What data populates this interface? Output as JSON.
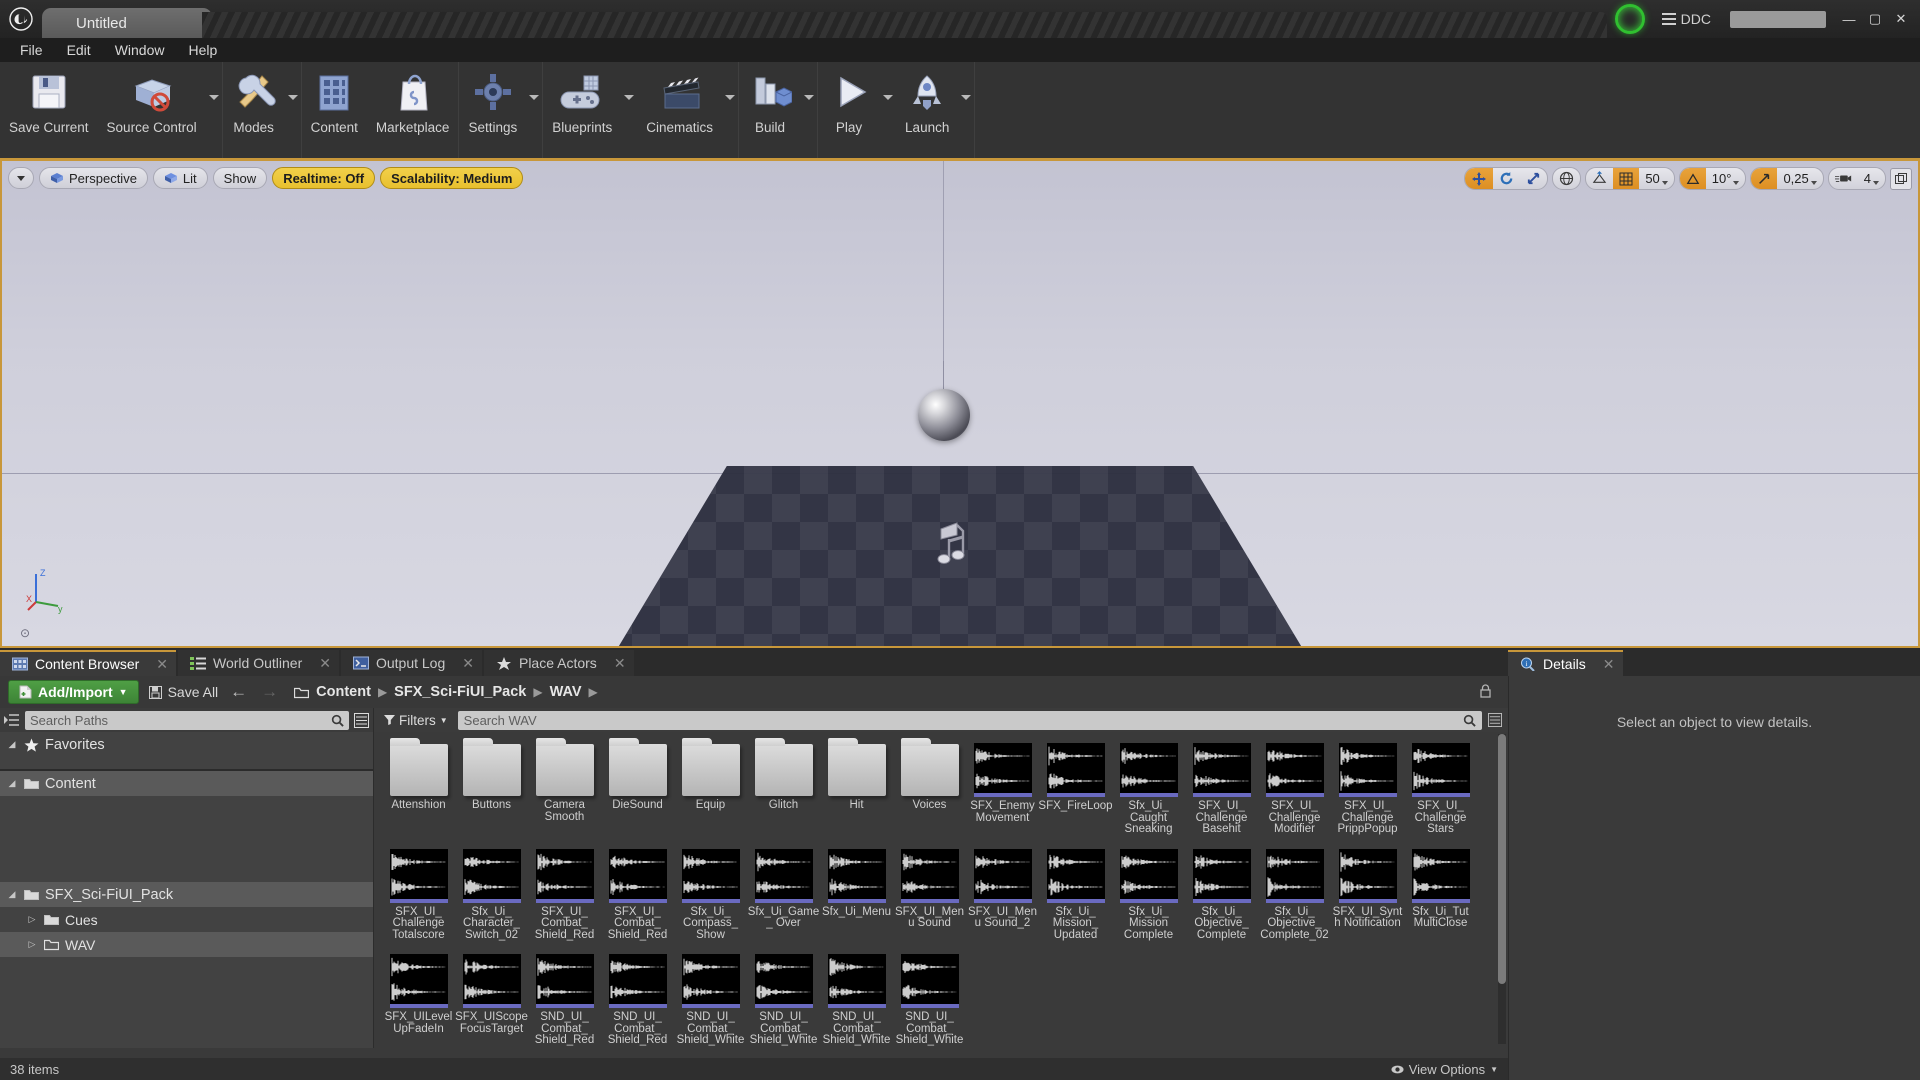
{
  "window": {
    "project_tab": "Untitled",
    "ddc_label": "DDC",
    "minimize": "—",
    "maximize": "▢",
    "close": "✕"
  },
  "menu": {
    "items": [
      "File",
      "Edit",
      "Window",
      "Help"
    ]
  },
  "toolbar": {
    "groups": [
      {
        "items": [
          {
            "label": "Save Current",
            "icon": "floppy-disk-icon",
            "arrow": false
          },
          {
            "label": "Source Control",
            "icon": "source-control-icon",
            "arrow": true
          }
        ]
      },
      {
        "items": [
          {
            "label": "Modes",
            "icon": "wrench-tools-icon",
            "arrow": true
          }
        ]
      },
      {
        "items": [
          {
            "label": "Content",
            "icon": "content-grid-icon",
            "arrow": false
          },
          {
            "label": "Marketplace",
            "icon": "marketplace-bag-icon",
            "arrow": false
          }
        ]
      },
      {
        "items": [
          {
            "label": "Settings",
            "icon": "gear-icon",
            "arrow": true
          }
        ]
      },
      {
        "items": [
          {
            "label": "Blueprints",
            "icon": "blueprint-gamepad-icon",
            "arrow": true
          },
          {
            "label": "Cinematics",
            "icon": "clapperboard-icon",
            "arrow": true
          }
        ]
      },
      {
        "items": [
          {
            "label": "Build",
            "icon": "build-cube-icon",
            "arrow": true
          }
        ]
      },
      {
        "items": [
          {
            "label": "Play",
            "icon": "play-icon",
            "arrow": true
          },
          {
            "label": "Launch",
            "icon": "launch-rocket-icon",
            "arrow": true
          }
        ]
      }
    ]
  },
  "viewport": {
    "left_controls": [
      {
        "name": "viewport-menu",
        "label": "",
        "type": "caret"
      },
      {
        "name": "perspective",
        "label": "Perspective",
        "type": "icon-label"
      },
      {
        "name": "view-mode-lit",
        "label": "Lit",
        "type": "icon-label"
      },
      {
        "name": "show",
        "label": "Show",
        "type": "plain"
      },
      {
        "name": "realtime",
        "label": "Realtime: Off",
        "type": "amber"
      },
      {
        "name": "scalability",
        "label": "Scalability: Medium",
        "type": "amber"
      }
    ],
    "right_controls": {
      "grid_snap_value": "50",
      "rotation_snap_value": "10°",
      "scale_snap_value": "0,25",
      "camera_speed_value": "4"
    }
  },
  "dock_tabs": [
    {
      "label": "Content Browser",
      "icon": "content-browser-icon",
      "active": true
    },
    {
      "label": "World Outliner",
      "icon": "world-outliner-icon",
      "active": false
    },
    {
      "label": "Output Log",
      "icon": "output-log-icon",
      "active": false
    },
    {
      "label": "Place Actors",
      "icon": "place-actors-icon",
      "active": false
    }
  ],
  "details_panel": {
    "tab_label": "Details",
    "empty_message": "Select an object to view details."
  },
  "content_browser": {
    "add_import_label": "Add/Import",
    "save_all_label": "Save All",
    "breadcrumbs": [
      "Content",
      "SFX_Sci-FiUI_Pack",
      "WAV"
    ],
    "path_search_placeholder": "Search Paths",
    "filters_label": "Filters",
    "asset_search_placeholder": "Search WAV",
    "status_count": "38 items",
    "view_options_label": "View Options",
    "tree": [
      {
        "label": "Favorites",
        "type": "favorites",
        "indent": 0,
        "expanded": true,
        "selected": false
      },
      {
        "label": "Content",
        "type": "folder",
        "indent": 0,
        "expanded": true,
        "selected": true
      },
      {
        "label": "SFX_Sci-FiUI_Pack",
        "type": "folder",
        "indent": 0,
        "expanded": true,
        "selected": true
      },
      {
        "label": "Cues",
        "type": "folder",
        "indent": 1,
        "expanded": false,
        "selected": false
      },
      {
        "label": "WAV",
        "type": "folder-open",
        "indent": 1,
        "expanded": false,
        "selected": true
      }
    ],
    "assets": [
      {
        "name": "Attenshion",
        "kind": "folder"
      },
      {
        "name": "Buttons",
        "kind": "folder"
      },
      {
        "name": "Camera Smooth",
        "kind": "folder"
      },
      {
        "name": "DieSound",
        "kind": "folder"
      },
      {
        "name": "Equip",
        "kind": "folder"
      },
      {
        "name": "Glitch",
        "kind": "folder"
      },
      {
        "name": "Hit",
        "kind": "folder"
      },
      {
        "name": "Voices",
        "kind": "folder"
      },
      {
        "name": "SFX_Enemy Movement",
        "kind": "sound"
      },
      {
        "name": "SFX_FireLoop",
        "kind": "sound"
      },
      {
        "name": "Sfx_Ui_ Caught Sneaking",
        "kind": "sound"
      },
      {
        "name": "SFX_UI_ Challenge Basehit",
        "kind": "sound"
      },
      {
        "name": "SFX_UI_ Challenge Modifier",
        "kind": "sound"
      },
      {
        "name": "SFX_UI_ Challenge PrippPopup",
        "kind": "sound"
      },
      {
        "name": "SFX_UI_ Challenge Stars",
        "kind": "sound"
      },
      {
        "name": "SFX_UI_ Challenge Totalscore",
        "kind": "sound"
      },
      {
        "name": "Sfx_Ui_ Character_ Switch_02",
        "kind": "sound"
      },
      {
        "name": "SFX_UI_ Combat_ Shield_Red",
        "kind": "sound"
      },
      {
        "name": "SFX_UI_ Combat_ Shield_Red",
        "kind": "sound"
      },
      {
        "name": "Sfx_Ui_ Compass_ Show",
        "kind": "sound"
      },
      {
        "name": "Sfx_Ui_Game_ Over",
        "kind": "sound"
      },
      {
        "name": "Sfx_Ui_Menu",
        "kind": "sound"
      },
      {
        "name": "SFX_UI_Menu Sound",
        "kind": "sound"
      },
      {
        "name": "SFX_UI_Menu Sound_2",
        "kind": "sound"
      },
      {
        "name": "Sfx_Ui_ Mission_ Updated",
        "kind": "sound"
      },
      {
        "name": "Sfx_Ui_ Mission Complete",
        "kind": "sound"
      },
      {
        "name": "Sfx_Ui_ Objective_ Complete",
        "kind": "sound"
      },
      {
        "name": "Sfx_Ui_ Objective_ Complete_02",
        "kind": "sound"
      },
      {
        "name": "SFX_UI_Synth Notification",
        "kind": "sound"
      },
      {
        "name": "Sfx_Ui_Tut MultiClose",
        "kind": "sound"
      },
      {
        "name": "SFX_UILevel UpFadeIn",
        "kind": "sound"
      },
      {
        "name": "SFX_UIScope FocusTarget",
        "kind": "sound"
      },
      {
        "name": "SND_UI_ Combat_ Shield_Red",
        "kind": "sound"
      },
      {
        "name": "SND_UI_ Combat_ Shield_Red",
        "kind": "sound"
      },
      {
        "name": "SND_UI_ Combat_ Shield_White",
        "kind": "sound"
      },
      {
        "name": "SND_UI_ Combat_ Shield_White",
        "kind": "sound"
      },
      {
        "name": "SND_UI_ Combat_ Shield_White",
        "kind": "sound"
      },
      {
        "name": "SND_UI_ Combat_ Shield_White",
        "kind": "sound"
      }
    ]
  }
}
